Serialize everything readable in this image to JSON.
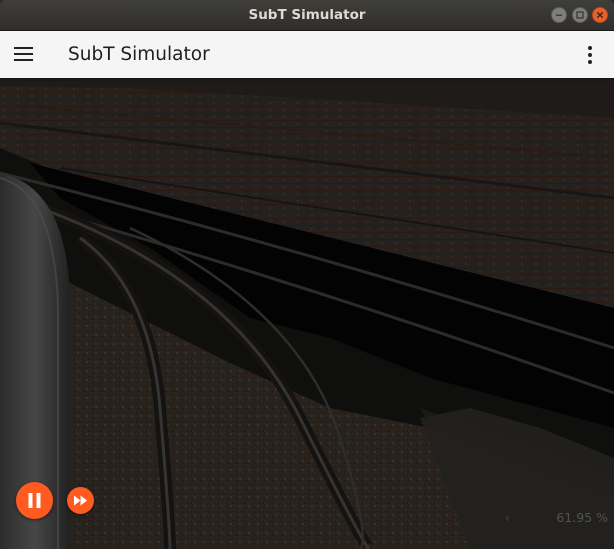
{
  "window": {
    "title": "SubT Simulator",
    "controls": [
      "minimize-icon",
      "maximize-icon",
      "close-icon"
    ]
  },
  "appbar": {
    "menu_icon": "hamburger-menu-icon",
    "title": "SubT Simulator",
    "overflow_icon": "more-vertical-icon"
  },
  "viewport": {
    "scene": "3d-rendered-tunnel-with-rail-tracks",
    "playback": {
      "pause_icon": "pause-icon",
      "fast_forward_icon": "fast-forward-icon"
    },
    "real_time_factor": {
      "chevron": "‹",
      "value": "61.95 %"
    }
  },
  "colors": {
    "accent": "#ff5a1f",
    "appbar_bg": "#f5f5f5",
    "titlebar_bg": "#3a3935",
    "close_button": "#e9602d"
  }
}
